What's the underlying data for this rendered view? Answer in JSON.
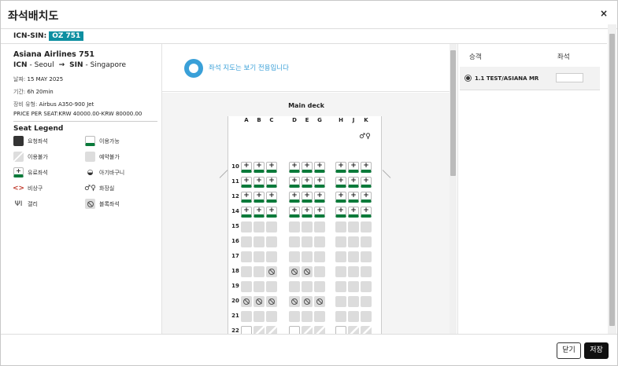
{
  "dialog": {
    "title": "좌석배치도",
    "close_icon": "×"
  },
  "route": {
    "code": "ICN-SIN:",
    "flight_badge": "OZ 751"
  },
  "flight": {
    "name": "Asiana Airlines 751",
    "origin_code": "ICN",
    "origin_city": "- Seoul",
    "dest_code": "SIN",
    "dest_city": "- Singapore",
    "date_label": "날짜:",
    "date_value": "15 MAY 2025",
    "duration_label": "기간:",
    "duration_value": "6h 20min",
    "equipment_label": "장비 유형:",
    "equipment_value": "Airbus A350-900 Jet",
    "price_line": "PRICE PER SEAT:KRW 40000.00-KRW 80000.00"
  },
  "legend": {
    "title": "Seat Legend",
    "items": [
      {
        "key": "requested",
        "label": "요청좌석"
      },
      {
        "key": "available",
        "label": "이용가능"
      },
      {
        "key": "unavailable",
        "label": "이용불가"
      },
      {
        "key": "reserved",
        "label": "예약불가"
      },
      {
        "key": "paid",
        "label": "유료좌석"
      },
      {
        "key": "bassinet",
        "label": "아기바구니"
      },
      {
        "key": "exit",
        "label": "비상구"
      },
      {
        "key": "lavatory",
        "label": "화장실"
      },
      {
        "key": "galley",
        "label": "갤리"
      },
      {
        "key": "blocked",
        "label": "블록좌석"
      }
    ]
  },
  "notice": {
    "view_only": "좌석 지도는 보기 전용입니다"
  },
  "seatmap": {
    "deck_title": "Main deck",
    "columns": [
      "A",
      "B",
      "C",
      "D",
      "E",
      "G",
      "H",
      "J",
      "K"
    ],
    "rows": [
      {
        "label": "10",
        "seats": [
          "paid",
          "paid",
          "paid",
          "paid",
          "paid",
          "paid",
          "paid",
          "paid",
          "paid"
        ]
      },
      {
        "label": "11",
        "seats": [
          "paid",
          "paid",
          "paid",
          "paid",
          "paid",
          "paid",
          "paid",
          "paid",
          "paid"
        ]
      },
      {
        "label": "12",
        "seats": [
          "paid",
          "paid",
          "paid",
          "paid",
          "paid",
          "paid",
          "paid",
          "paid",
          "paid"
        ]
      },
      {
        "label": "14",
        "seats": [
          "paid",
          "paid",
          "paid",
          "paid",
          "paid",
          "paid",
          "paid",
          "paid",
          "paid"
        ]
      },
      {
        "label": "15",
        "seats": [
          "reserved",
          "reserved",
          "reserved",
          "reserved",
          "reserved",
          "reserved",
          "reserved",
          "reserved",
          "reserved"
        ]
      },
      {
        "label": "16",
        "seats": [
          "reserved",
          "reserved",
          "reserved",
          "reserved",
          "reserved",
          "reserved",
          "reserved",
          "reserved",
          "reserved"
        ]
      },
      {
        "label": "17",
        "seats": [
          "reserved",
          "reserved",
          "reserved",
          "reserved",
          "reserved",
          "reserved",
          "reserved",
          "reserved",
          "reserved"
        ]
      },
      {
        "label": "18",
        "seats": [
          "reserved",
          "reserved",
          "blocked",
          "blocked",
          "blocked",
          "reserved",
          "reserved",
          "reserved",
          "reserved"
        ]
      },
      {
        "label": "19",
        "seats": [
          "reserved",
          "reserved",
          "reserved",
          "reserved",
          "reserved",
          "reserved",
          "reserved",
          "reserved",
          "reserved"
        ]
      },
      {
        "label": "20",
        "seats": [
          "blocked",
          "blocked",
          "blocked",
          "blocked",
          "blocked",
          "blocked",
          "reserved",
          "reserved",
          "reserved"
        ]
      },
      {
        "label": "21",
        "seats": [
          "reserved",
          "reserved",
          "reserved",
          "reserved",
          "reserved",
          "reserved",
          "reserved",
          "reserved",
          "reserved"
        ]
      },
      {
        "label": "22",
        "seats": [
          "exit",
          "unavailable",
          "unavailable",
          "exit",
          "unavailable",
          "unavailable",
          "exit",
          "unavailable",
          "unavailable"
        ]
      }
    ]
  },
  "passengers": {
    "header_passenger": "승객",
    "header_seat": "좌석",
    "list": [
      {
        "name": "1.1 TEST/ASIANA MR",
        "seat": ""
      }
    ]
  },
  "footer": {
    "close_label": "닫기",
    "save_label": "저장"
  }
}
